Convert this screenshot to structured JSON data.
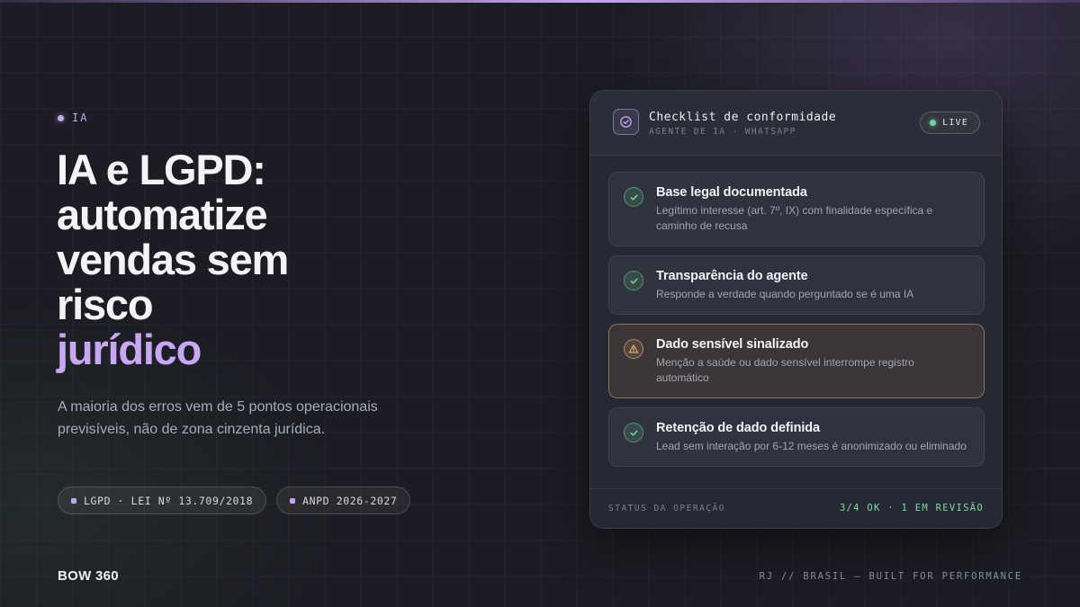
{
  "theme": {
    "accent": "#c8a7f3",
    "success": "#6fd49a",
    "warning": "#e1a573",
    "background": "#1c1d24"
  },
  "hero": {
    "eyebrow": "IA",
    "headline_lines": [
      "IA e LGPD:",
      "automatize",
      "vendas sem",
      "risco"
    ],
    "headline_accent": "jurídico",
    "subtitle": "A maioria dos erros vem de 5 pontos operacionais previsíveis, não de zona cinzenta jurídica.",
    "tags": [
      "LGPD · LEI Nº 13.709/2018",
      "ANPD 2026-2027"
    ]
  },
  "card": {
    "title": "Checklist de conformidade",
    "subtitle": "AGENTE DE IA · WHATSAPP",
    "live_label": "LIVE",
    "header_icon": "check-circle-icon",
    "items": [
      {
        "status": "ok",
        "icon": "check-icon",
        "title": "Base legal documentada",
        "description": "Legítimo interesse (art. 7º, IX) com finalidade específica e caminho de recusa"
      },
      {
        "status": "ok",
        "icon": "check-icon",
        "title": "Transparência do agente",
        "description": "Responde a verdade quando perguntado se é uma IA"
      },
      {
        "status": "warning",
        "icon": "warning-triangle-icon",
        "title": "Dado sensível sinalizado",
        "description": "Menção a saúde ou dado sensível interrompe registro automático"
      },
      {
        "status": "ok",
        "icon": "check-icon",
        "title": "Retenção de dado definida",
        "description": "Lead sem interação por 6-12 meses é anonimizado ou eliminado"
      }
    ],
    "footer": {
      "status_label": "STATUS DA OPERAÇÃO",
      "status_value": "3/4 OK · 1 EM REVISÃO"
    }
  },
  "footer": {
    "brand": "BOW 360",
    "tagline": "RJ // BRASIL — BUILT FOR PERFORMANCE"
  }
}
